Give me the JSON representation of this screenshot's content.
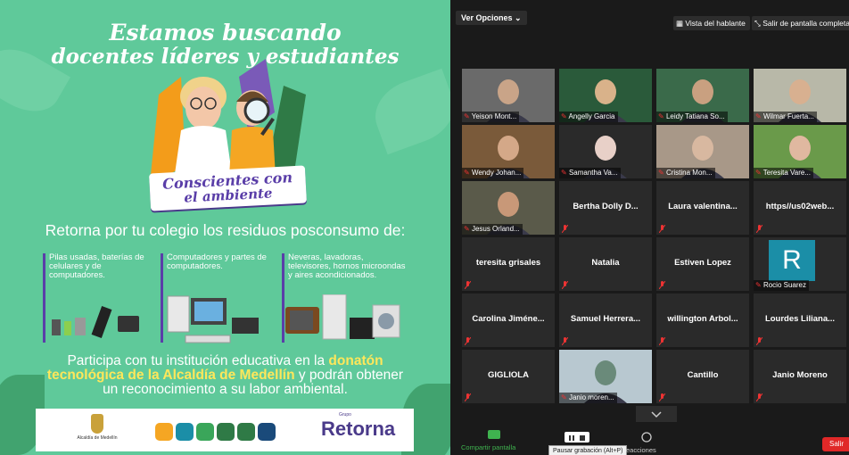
{
  "poster": {
    "headline_line1": "Estamos buscando",
    "headline_line2": "docentes líderes y estudiantes",
    "banner_line1": "Conscientes con",
    "banner_line2": "el ambiente",
    "retorna_line": "Retorna por tu colegio los residuos posconsumo de:",
    "categories": [
      "Pilas usadas, baterías de celulares y de computadores.",
      "Computadores y partes de computadores.",
      "Neveras, lavadoras, televisores, hornos microondas y aires acondicionados."
    ],
    "cta_part1": "Participa con tu institución educativa en la",
    "cta_highlight1": "donatón",
    "cta_highlight2": "tecnológica de la Alcaldía de Medellín",
    "cta_part2": "y podrán obtener",
    "cta_line3": "un reconocimiento a su labor ambiental.",
    "logos": {
      "alcaldia": "Alcaldía de Medellín",
      "retorna": "Retorna",
      "grupo": "Grupo"
    }
  },
  "zoom": {
    "ver_opciones": "Ver Opciones",
    "vista": "Vista del hablante",
    "salir_pantalla": "Salir de pantalla completa",
    "tiles": [
      {
        "label": "Yeison Mont...",
        "name": ""
      },
      {
        "label": "Angelly Garcia",
        "name": ""
      },
      {
        "label": "Leidy Tatiana So...",
        "name": ""
      },
      {
        "label": "Wilmar Fuerta...",
        "name": ""
      },
      {
        "label": "Wendy Johan...",
        "name": ""
      },
      {
        "label": "Samantha Va...",
        "name": ""
      },
      {
        "label": "Cristina Mon...",
        "name": ""
      },
      {
        "label": "Teresita Vare...",
        "name": ""
      },
      {
        "label": "Jesus Orland...",
        "name": ""
      },
      {
        "label": "",
        "name": "Bertha Dolly D..."
      },
      {
        "label": "",
        "name": "Laura valentina..."
      },
      {
        "label": "",
        "name": "https//us02web..."
      },
      {
        "label": "",
        "name": "teresita grisales"
      },
      {
        "label": "",
        "name": "Natalia"
      },
      {
        "label": "",
        "name": "Estiven Lopez"
      },
      {
        "label": "Rocio Suarez",
        "name": ""
      },
      {
        "label": "",
        "name": "Carolina Jiméne..."
      },
      {
        "label": "",
        "name": "Samuel Herrera..."
      },
      {
        "label": "",
        "name": "willington Arbol..."
      },
      {
        "label": "",
        "name": "Lourdes Liliana..."
      },
      {
        "label": "",
        "name": "GIGLIOLA"
      },
      {
        "label": "Janio moren...",
        "name": ""
      },
      {
        "label": "",
        "name": "Cantillo"
      },
      {
        "label": "",
        "name": "Janio Moreno"
      }
    ],
    "rocio_initial": "R",
    "share_label": "Compartir pantalla",
    "pause_tooltip": "Pausar grabación (Alt+P)",
    "reactions_label": "eacciones",
    "leave_label": "Salir"
  }
}
